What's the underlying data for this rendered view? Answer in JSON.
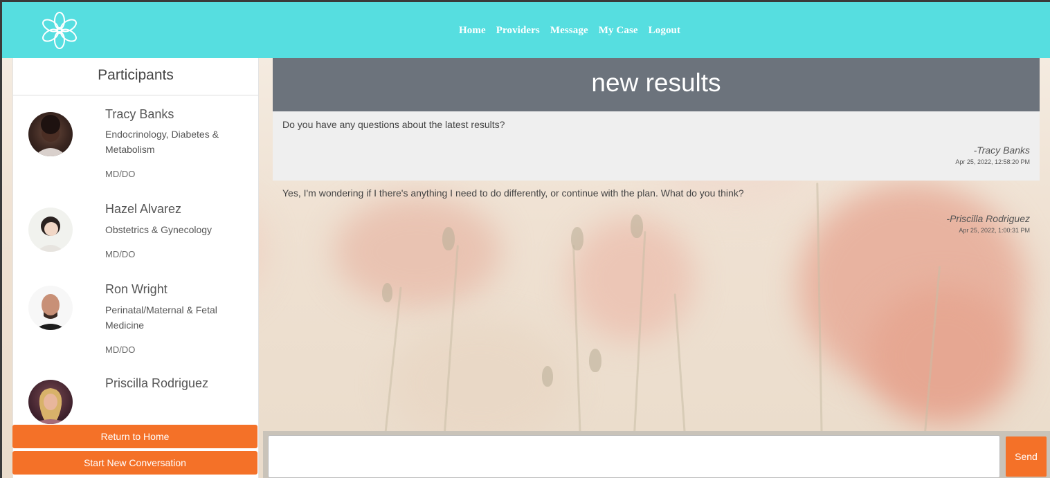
{
  "header": {
    "logo_icon": "flower-logo-icon",
    "nav": [
      {
        "label": "Home"
      },
      {
        "label": "Providers"
      },
      {
        "label": "Message"
      },
      {
        "label": "My Case"
      },
      {
        "label": "Logout"
      }
    ],
    "background_color": "#56dee0"
  },
  "participants": {
    "title": "Participants",
    "items": [
      {
        "name": "Tracy Banks",
        "specialty": "Endocrinology, Diabetes & Metabolism",
        "credential": "MD/DO"
      },
      {
        "name": "Hazel Alvarez",
        "specialty": "Obstetrics & Gynecology",
        "credential": "MD/DO"
      },
      {
        "name": "Ron Wright",
        "specialty": "Perinatal/Maternal & Fetal Medicine",
        "credential": "MD/DO"
      },
      {
        "name": "Priscilla Rodriguez",
        "specialty": "",
        "credential": ""
      }
    ]
  },
  "actions": {
    "return_home": "Return to Home",
    "start_new": "Start New Conversation"
  },
  "conversation": {
    "title": "new results",
    "messages": [
      {
        "text": "Do you have any questions about the latest results?",
        "author": "-Tracy Banks",
        "time": "Apr 25, 2022, 12:58:20 PM"
      },
      {
        "text": "Yes, I'm wondering if I there's anything I need to do differently, or continue with the plan. What do you think?",
        "author": "-Priscilla Rodriguez",
        "time": "Apr 25, 2022, 1:00:31 PM"
      }
    ]
  },
  "composer": {
    "value": "",
    "send_label": "Send"
  },
  "colors": {
    "accent_orange": "#f47128",
    "title_bar": "#6c737c"
  }
}
